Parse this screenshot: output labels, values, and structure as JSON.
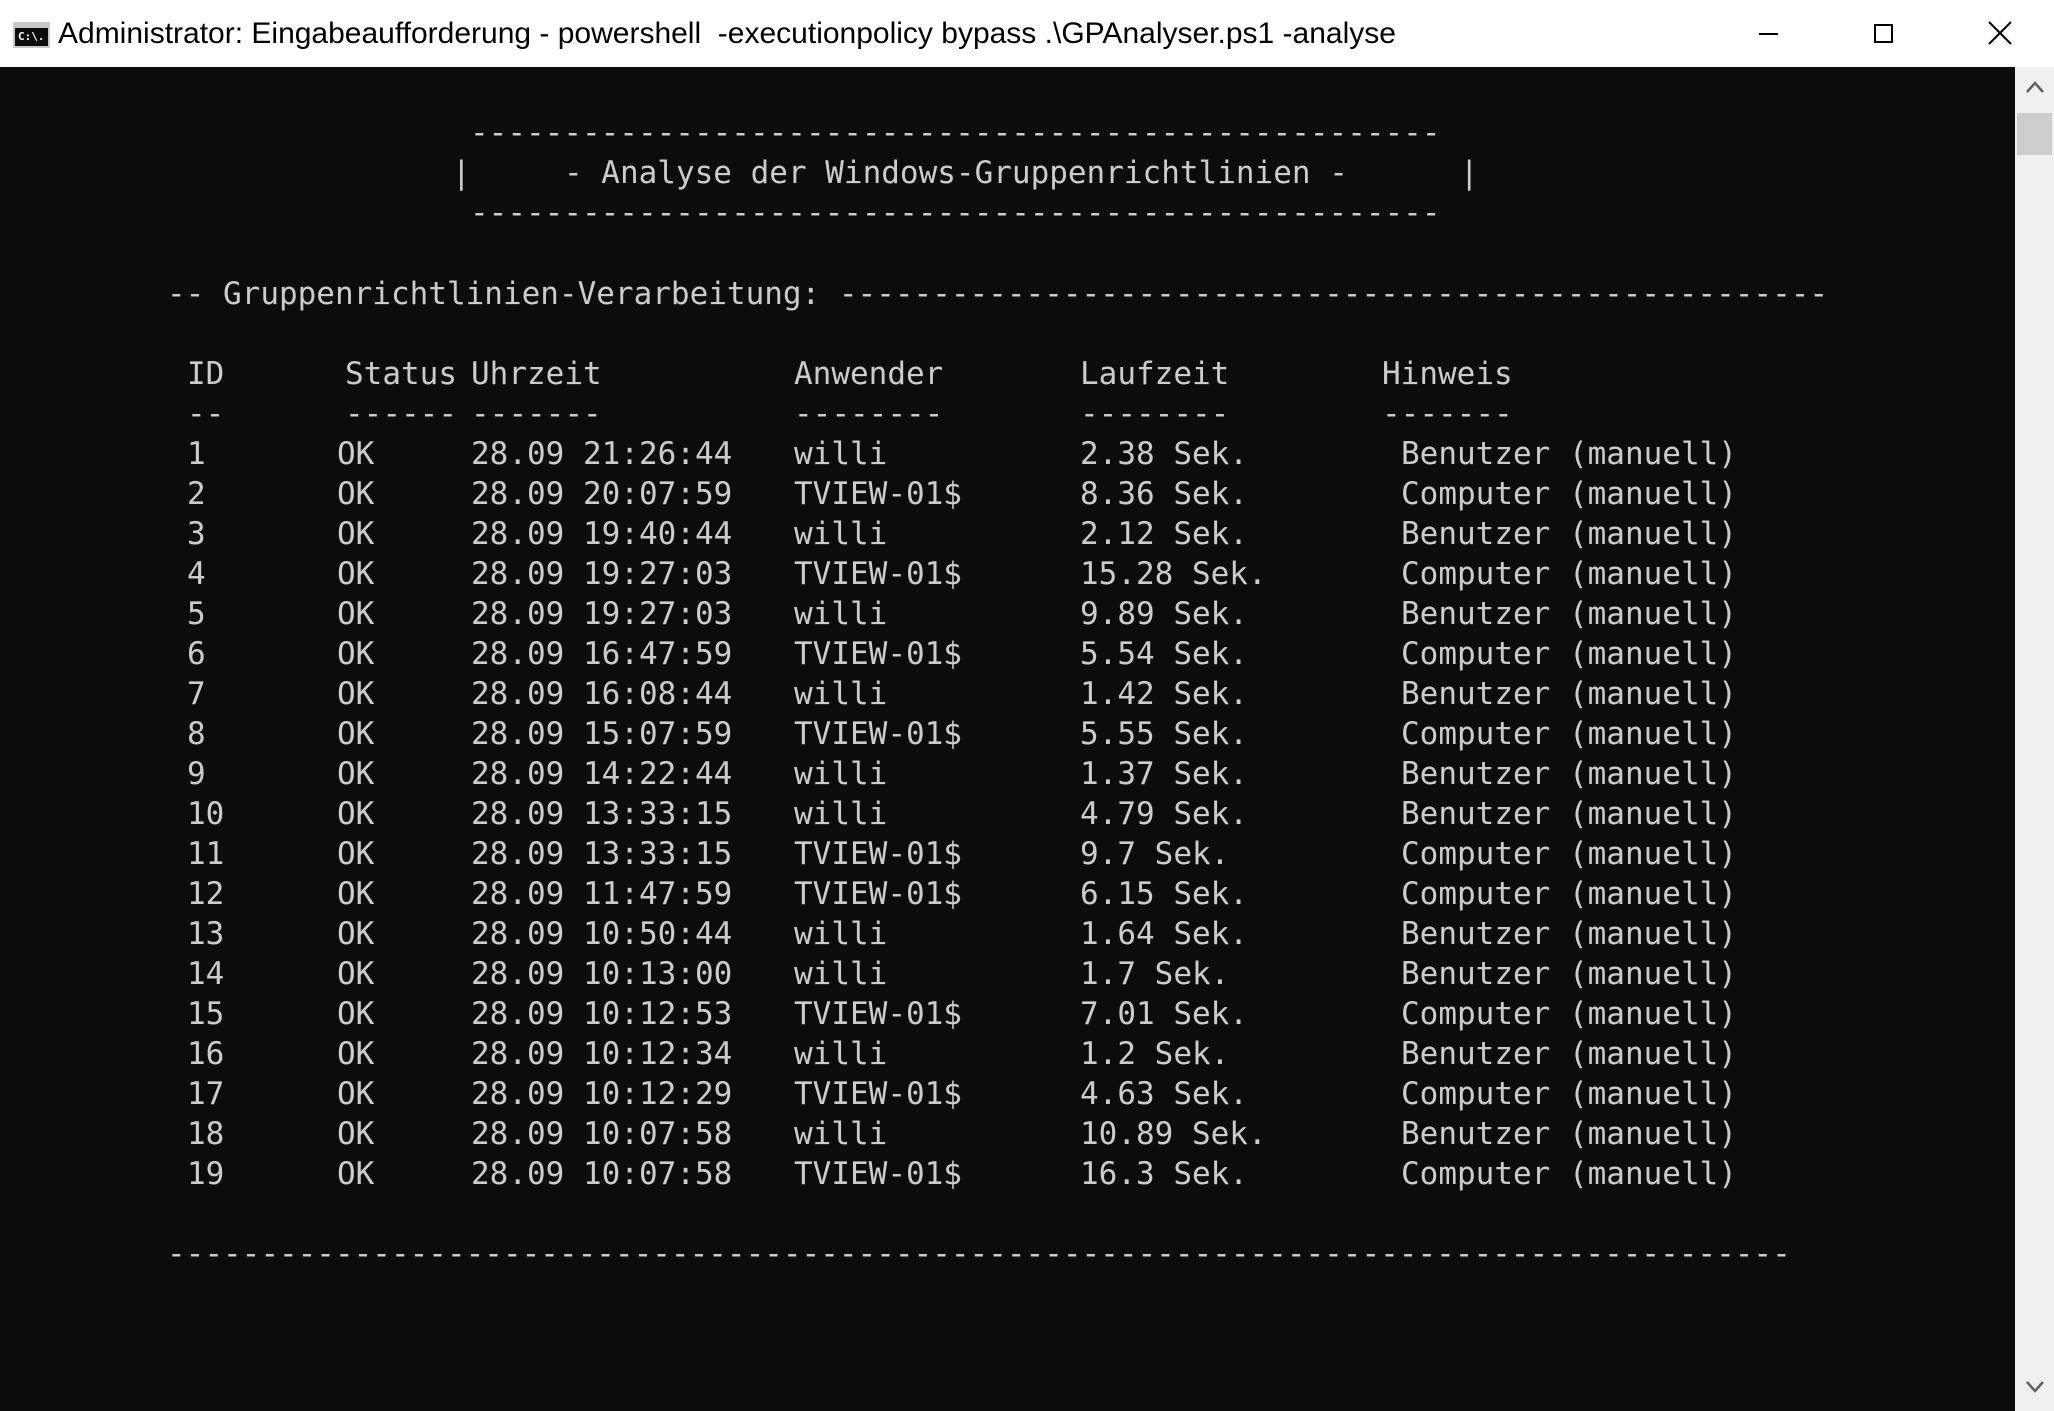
{
  "window": {
    "title": "Administrator: Eingabeaufforderung - powershell  -executionpolicy bypass .\\GPAnalyser.ps1 -analyse",
    "icon_text": "C:\\."
  },
  "console": {
    "banner_rule": "----------------------------------------------------",
    "banner_text": "|     - Analyse der Windows-Gruppenrichtlinien -      |",
    "section_header": "-- Gruppenrichtlinien-Verarbeitung: -----------------------------------------------------",
    "columns": [
      "ID",
      "Status",
      "Uhrzeit",
      "Anwender",
      "Laufzeit",
      "Hinweis"
    ],
    "underlines": [
      "--",
      "------",
      "-------",
      "--------",
      "--------",
      "-------"
    ],
    "rows": [
      [
        "1",
        "OK",
        "28.09 21:26:44",
        "willi",
        "2.38 Sek.",
        "Benutzer (manuell)"
      ],
      [
        "2",
        "OK",
        "28.09 20:07:59",
        "TVIEW-01$",
        "8.36 Sek.",
        "Computer (manuell)"
      ],
      [
        "3",
        "OK",
        "28.09 19:40:44",
        "willi",
        "2.12 Sek.",
        "Benutzer (manuell)"
      ],
      [
        "4",
        "OK",
        "28.09 19:27:03",
        "TVIEW-01$",
        "15.28 Sek.",
        "Computer (manuell)"
      ],
      [
        "5",
        "OK",
        "28.09 19:27:03",
        "willi",
        "9.89 Sek.",
        "Benutzer (manuell)"
      ],
      [
        "6",
        "OK",
        "28.09 16:47:59",
        "TVIEW-01$",
        "5.54 Sek.",
        "Computer (manuell)"
      ],
      [
        "7",
        "OK",
        "28.09 16:08:44",
        "willi",
        "1.42 Sek.",
        "Benutzer (manuell)"
      ],
      [
        "8",
        "OK",
        "28.09 15:07:59",
        "TVIEW-01$",
        "5.55 Sek.",
        "Computer (manuell)"
      ],
      [
        "9",
        "OK",
        "28.09 14:22:44",
        "willi",
        "1.37 Sek.",
        "Benutzer (manuell)"
      ],
      [
        "10",
        "OK",
        "28.09 13:33:15",
        "willi",
        "4.79 Sek.",
        "Benutzer (manuell)"
      ],
      [
        "11",
        "OK",
        "28.09 13:33:15",
        "TVIEW-01$",
        "9.7 Sek.",
        "Computer (manuell)"
      ],
      [
        "12",
        "OK",
        "28.09 11:47:59",
        "TVIEW-01$",
        "6.15 Sek.",
        "Computer (manuell)"
      ],
      [
        "13",
        "OK",
        "28.09 10:50:44",
        "willi",
        "1.64 Sek.",
        "Benutzer (manuell)"
      ],
      [
        "14",
        "OK",
        "28.09 10:13:00",
        "willi",
        "1.7 Sek.",
        "Benutzer (manuell)"
      ],
      [
        "15",
        "OK",
        "28.09 10:12:53",
        "TVIEW-01$",
        "7.01 Sek.",
        "Computer (manuell)"
      ],
      [
        "16",
        "OK",
        "28.09 10:12:34",
        "willi",
        "1.2 Sek.",
        "Benutzer (manuell)"
      ],
      [
        "17",
        "OK",
        "28.09 10:12:29",
        "TVIEW-01$",
        "4.63 Sek.",
        "Computer (manuell)"
      ],
      [
        "18",
        "OK",
        "28.09 10:07:58",
        "willi",
        "10.89 Sek.",
        "Benutzer (manuell)"
      ],
      [
        "19",
        "OK",
        "28.09 10:07:58",
        "TVIEW-01$",
        "16.3 Sek.",
        "Computer (manuell)"
      ]
    ],
    "footer_rule": "---------------------------------------------------------------------------------------"
  }
}
